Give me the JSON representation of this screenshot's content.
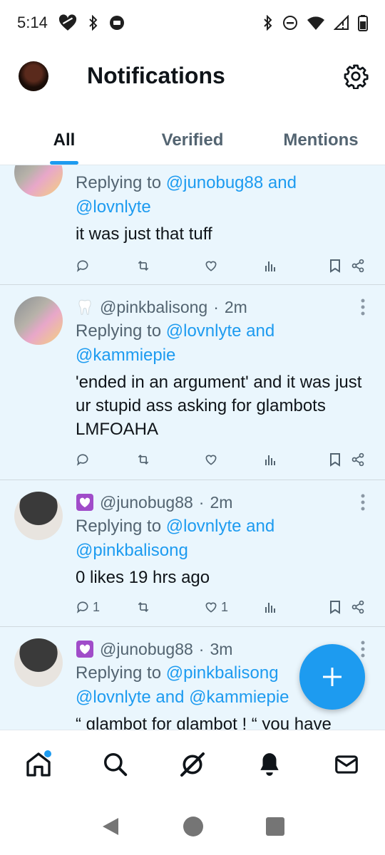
{
  "status_bar": {
    "time": "5:14"
  },
  "header": {
    "title": "Notifications"
  },
  "tabs": [
    {
      "label": "All"
    },
    {
      "label": "Verified"
    },
    {
      "label": "Mentions"
    }
  ],
  "feed": [
    {
      "replying_prefix": "Replying to ",
      "reply_to_line1": "@junobug88 and",
      "reply_to_line2": "@lovnlyte",
      "text": "it was just that tuff",
      "actions": {
        "reply_count": "",
        "like_count": ""
      }
    },
    {
      "badge": "tooth-icon",
      "handle": "@pinkbalisong",
      "time": "2m",
      "replying_prefix": "Replying to ",
      "reply_to_line1": "@lovnlyte and",
      "reply_to_line2": "@kammiepie",
      "text": "'ended in an argument' and it was just ur stupid ass asking for glambots LMFOAHA",
      "actions": {
        "reply_count": "",
        "like_count": ""
      }
    },
    {
      "badge": "heart-box-icon",
      "handle": "@junobug88",
      "time": "2m",
      "replying_prefix": "Replying to ",
      "reply_to_line1": "@lovnlyte and",
      "reply_to_line2": "@pinkbalisong",
      "text": "0 likes 19 hrs ago",
      "actions": {
        "reply_count": "1",
        "like_count": "1"
      }
    },
    {
      "badge": "heart-box-icon",
      "handle": "@junobug88",
      "time": "3m",
      "replying_prefix": "Replying to ",
      "reply_to_line1": "@pinkbalisong",
      "reply_to_line2": "@lovnlyte and @kammiepie",
      "text": "“ glambot for glambot ! “ you have"
    }
  ],
  "colors": {
    "accent": "#1d9bf0",
    "feed_bg": "#eaf6fd"
  }
}
